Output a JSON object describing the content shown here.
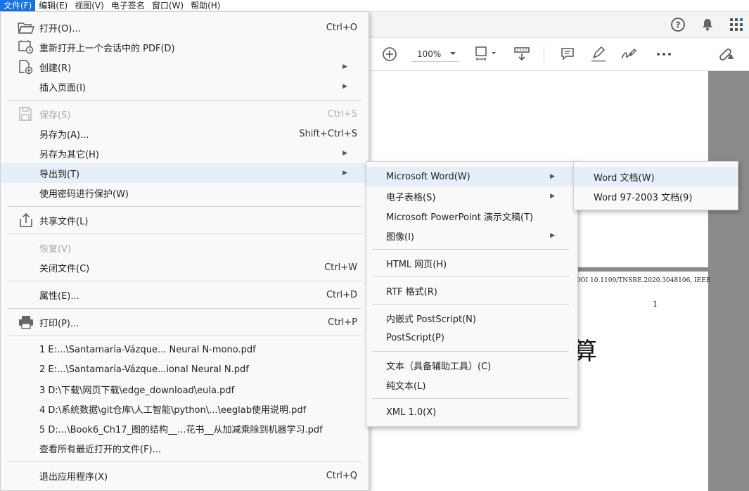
{
  "menubar": [
    {
      "label": "文件(F)",
      "active": true
    },
    {
      "label": "编辑(E)"
    },
    {
      "label": "视图(V)"
    },
    {
      "label": "电子签名"
    },
    {
      "label": "窗口(W)"
    },
    {
      "label": "帮助(H)"
    }
  ],
  "toolbar": {
    "zoom": "100%"
  },
  "file_menu": {
    "open": {
      "label": "打开(O)...",
      "shortcut": "Ctrl+O"
    },
    "reopen": {
      "label": "重新打开上一个会话中的 PDF(D)"
    },
    "create": {
      "label": "创建(R)"
    },
    "insert_page": {
      "label": "插入页面(I)"
    },
    "save": {
      "label": "保存(S)",
      "shortcut": "Ctrl+S"
    },
    "save_as": {
      "label": "另存为(A)...",
      "shortcut": "Shift+Ctrl+S"
    },
    "save_as_other": {
      "label": "另存为其它(H)"
    },
    "export_to": {
      "label": "导出到(T)"
    },
    "protect": {
      "label": "使用密码进行保护(W)"
    },
    "share": {
      "label": "共享文件(L)"
    },
    "revert": {
      "label": "恢复(V)"
    },
    "close": {
      "label": "关闭文件(C)",
      "shortcut": "Ctrl+W"
    },
    "properties": {
      "label": "属性(E)...",
      "shortcut": "Ctrl+D"
    },
    "print": {
      "label": "打印(P)...",
      "shortcut": "Ctrl+P"
    },
    "recent": [
      "1 E:...\\Santamaría-Vázque... Neural N-mono.pdf",
      "2 E:...\\Santamaría-Vázque...ional Neural N.pdf",
      "3 D:\\下载\\网页下载\\edge_download\\eula.pdf",
      "4 D:\\系统数据\\git仓库\\人工智能\\python\\...\\eeglab使用说明.pdf",
      "5 D:...\\Book6_Ch17_图的结构__...花书__从加减乘除到机器学习.pdf"
    ],
    "view_all_recent": {
      "label": "查看所有最近打开的文件(F)..."
    },
    "exit": {
      "label": "退出应用程序(X)",
      "shortcut": "Ctrl+Q"
    }
  },
  "export_menu": {
    "word": "Microsoft Word(W)",
    "spreadsheet": "电子表格(S)",
    "powerpoint": "Microsoft PowerPoint 演示文稿(T)",
    "image": "图像(I)",
    "html": "HTML 网页(H)",
    "rtf": "RTF 格式(R)",
    "embedded_ps": "内嵌式 PostScript(N)",
    "postscript": "PostScript(P)",
    "text_accessible": "文本（具备辅助工具）(C)",
    "plain_text": "纯文本(L)",
    "xml": "XML 1.0(X)"
  },
  "word_menu": {
    "word_doc": "Word 文档(W)",
    "word_97": "Word 97-2003 文档(9)"
  },
  "document": {
    "doi_line": "DOI 10.1109/TNSRE.2020.3048106, IEEE",
    "page_number": "1",
    "heading_fragment": "算"
  },
  "colors": {
    "accent": "#1473e6",
    "highlight": "#e5eef9",
    "menu_bg": "#f9f9f9"
  }
}
